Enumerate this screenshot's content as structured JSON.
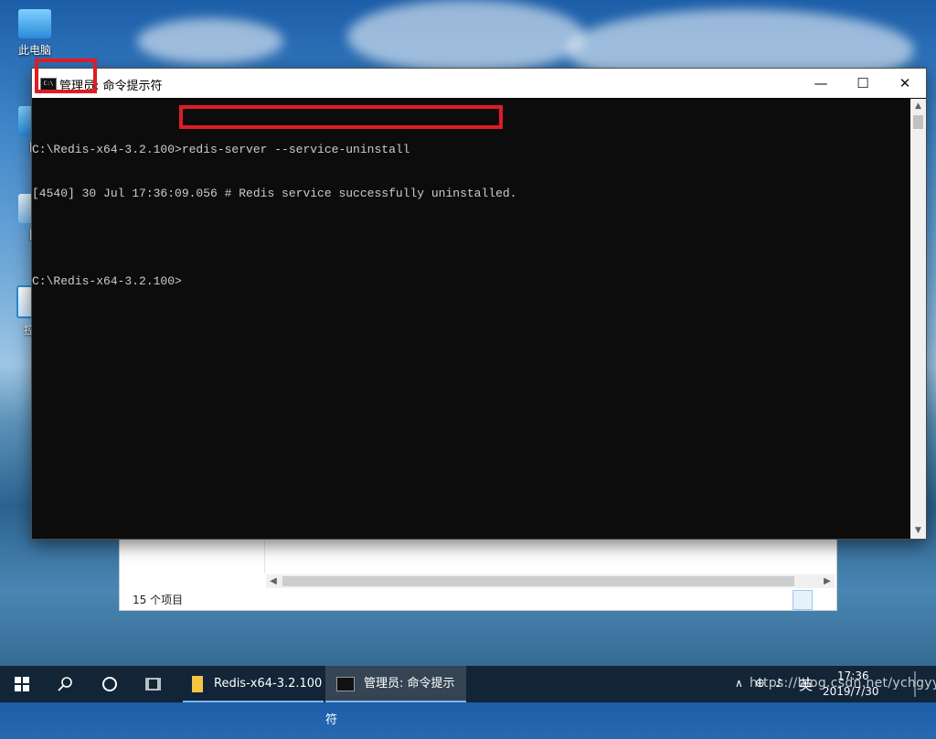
{
  "desktop": {
    "icons": [
      {
        "label": "此电脑",
        "icon": "computer-icon"
      },
      {
        "label": "网",
        "icon": "network-icon"
      },
      {
        "label": "回",
        "icon": "recycle-bin-icon"
      },
      {
        "label": "控制",
        "icon": "control-panel-icon"
      }
    ]
  },
  "cmd_window": {
    "title": "管理员: 命令提示符",
    "icon_text": "C:\\",
    "minimize": "—",
    "maximize": "☐",
    "close": "✕",
    "lines": [
      "C:\\Redis-x64-3.2.100>redis-server --service-uninstall",
      "[4540] 30 Jul 17:36:09.056 # Redis service successfully uninstalled.",
      "",
      "C:\\Redis-x64-3.2.100>"
    ],
    "scroll_up": "▲",
    "scroll_down": "▼"
  },
  "explorer": {
    "status": "15 个项目",
    "scroll_left": "◀",
    "scroll_right": "▶"
  },
  "taskbar": {
    "start_icon": "windows-logo-icon",
    "search_icon": "search-icon",
    "cortana_icon": "cortana-icon",
    "taskview_icon": "task-view-icon",
    "apps": [
      {
        "label": "Redis-x64-3.2.100",
        "icon": "folder-icon",
        "active": false
      },
      {
        "label": "管理员: 命令提示符",
        "icon": "cmd-icon",
        "active": true
      }
    ],
    "tray": {
      "chevron": "∧",
      "ime": "英",
      "time": "17:36",
      "date": "2019/7/30"
    }
  },
  "watermark": "https://blog.csdn.net/ychgyyn",
  "colors": {
    "highlight": "#e01b24",
    "console_bg": "#0c0c0c",
    "console_text": "#cccccc"
  }
}
